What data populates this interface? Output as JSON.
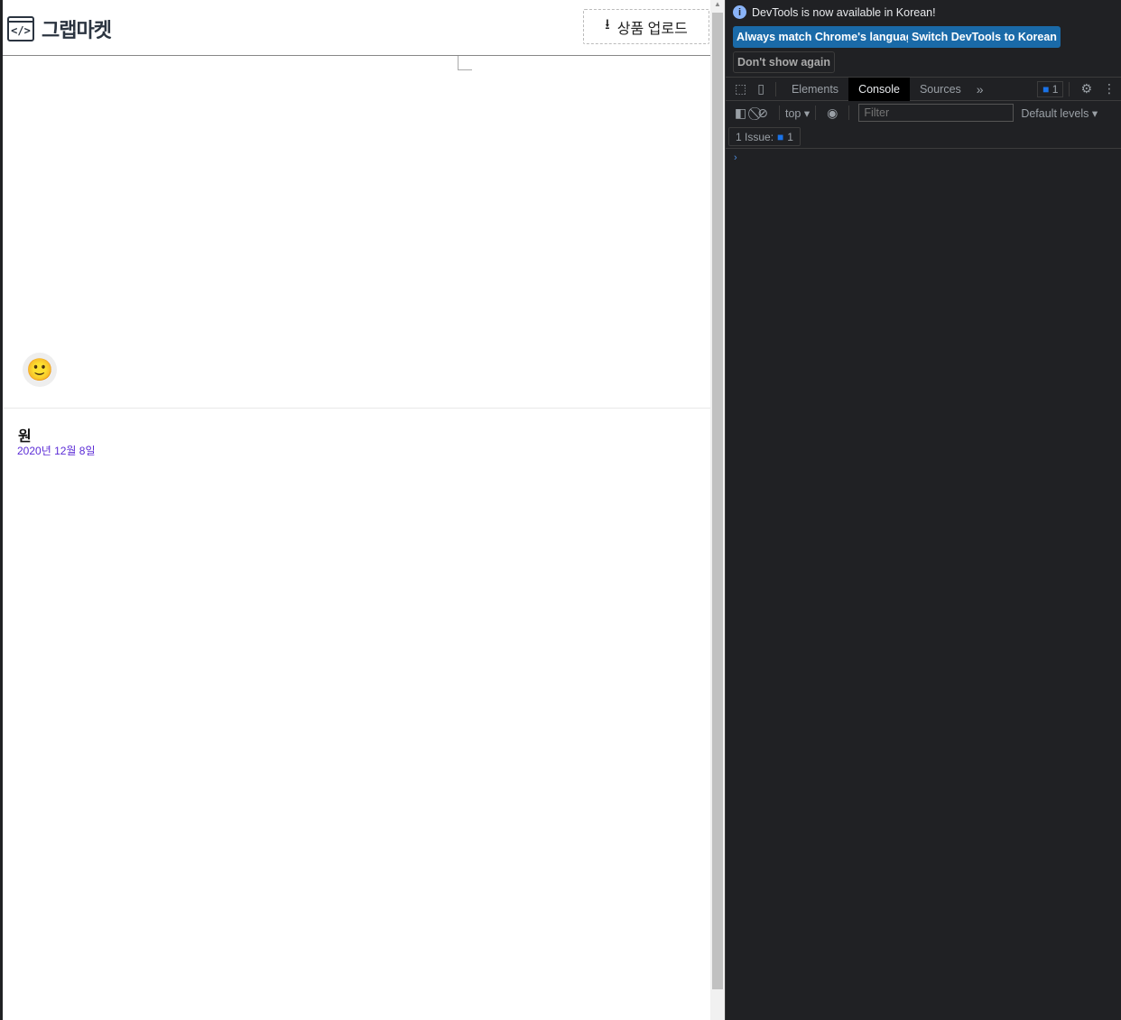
{
  "app": {
    "logo_text": "그랩마켓",
    "logo_icon": "</>",
    "upload_label": "상품 업로드"
  },
  "product": {
    "price": "원",
    "date": "2020년 12월 8일"
  },
  "devtools": {
    "banner": "DevTools is now available in Korean!",
    "btn_match": "Always match Chrome's language",
    "btn_switch": "Switch DevTools to Korean",
    "btn_dont": "Don't show again",
    "tabs": [
      "Elements",
      "Console",
      "Sources"
    ],
    "issues_badge": "1",
    "context": "top",
    "filter_placeholder": "Filter",
    "levels": "Default levels",
    "issue_label": "1 Issue:",
    "issue_count": "1"
  }
}
